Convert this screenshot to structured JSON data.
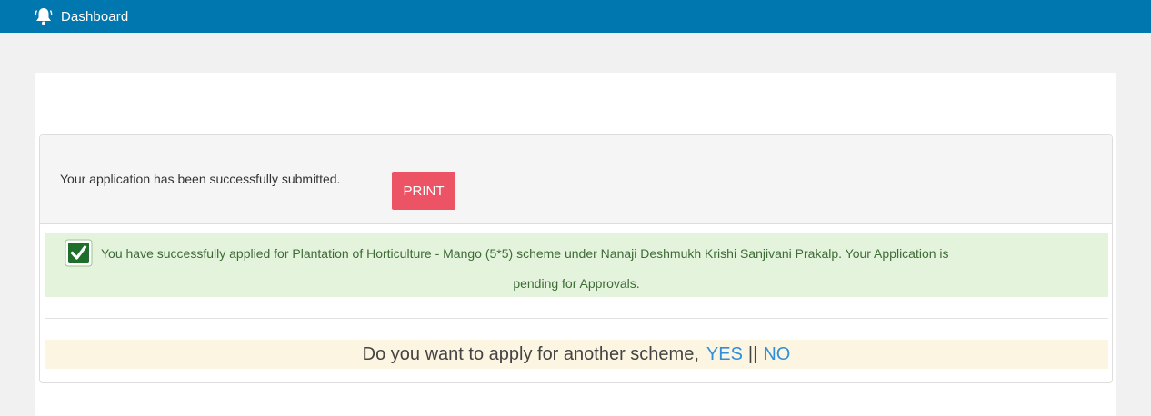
{
  "header": {
    "title": "Dashboard",
    "icon": "bell-icon",
    "background_color": "#0077ae"
  },
  "submission": {
    "message": "Your application has been successfully submitted.",
    "print_label": "PRINT",
    "print_color": "#ec5364"
  },
  "success_alert": {
    "icon": "checkbox-check-icon",
    "line1": "You have successfully applied for Plantation of Horticulture - Mango (5*5) scheme under Nanaji Deshmukh Krishi Sanjivani Prakalp. Your Application is",
    "line2": "pending for Approvals.",
    "background_color": "#e4f3dc"
  },
  "another_scheme": {
    "question": "Do you want to apply for another scheme,",
    "yes_label": "YES",
    "separator": "||",
    "no_label": "NO",
    "link_color": "#2f8fdc"
  }
}
